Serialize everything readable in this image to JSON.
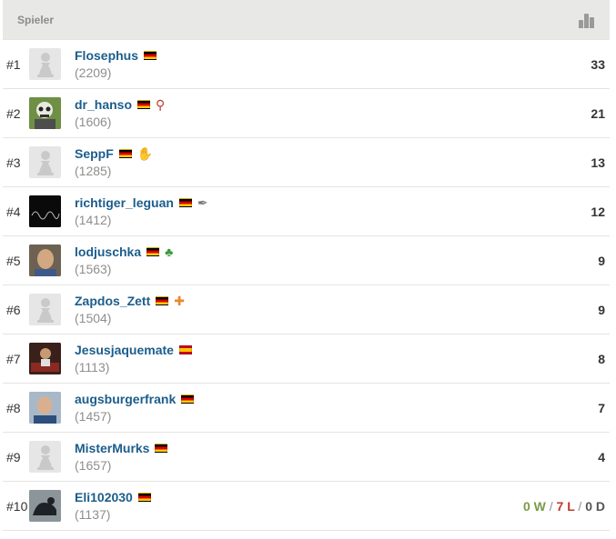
{
  "header": {
    "label": "Spieler",
    "icon": "leaderboard-icon"
  },
  "colors": {
    "link": "#1b5d8c",
    "rating": "#8e8e8c",
    "header_bg": "#e8e8e6",
    "win": "#7b9a4a",
    "loss": "#c0392b"
  },
  "rows": [
    {
      "rank": "#1",
      "username": "Flosephus",
      "rating": "(2209)",
      "flag": "de",
      "badge": "",
      "avatar": "pawn",
      "score": "33"
    },
    {
      "rank": "#2",
      "username": "dr_hanso",
      "rating": "(1606)",
      "flag": "de",
      "badge": "puzzle-badge-icon",
      "avatar": "photo",
      "score": "21"
    },
    {
      "rank": "#3",
      "username": "SeppF",
      "rating": "(1285)",
      "flag": "de",
      "badge": "clap-badge-icon",
      "avatar": "pawn",
      "score": "13"
    },
    {
      "rank": "#4",
      "username": "richtiger_leguan",
      "rating": "(1412)",
      "flag": "de",
      "badge": "feather-badge-icon",
      "avatar": "photo",
      "score": "12"
    },
    {
      "rank": "#5",
      "username": "lodjuschka",
      "rating": "(1563)",
      "flag": "de",
      "badge": "clover-badge-icon",
      "avatar": "photo",
      "score": "9"
    },
    {
      "rank": "#6",
      "username": "Zapdos_Zett",
      "rating": "(1504)",
      "flag": "de",
      "badge": "puzzle-piece-badge-icon",
      "avatar": "pawn",
      "score": "9"
    },
    {
      "rank": "#7",
      "username": "Jesusjaquemate",
      "rating": "(1113)",
      "flag": "es",
      "badge": "",
      "avatar": "photo",
      "score": "8"
    },
    {
      "rank": "#8",
      "username": "augsburgerfrank",
      "rating": "(1457)",
      "flag": "de",
      "badge": "",
      "avatar": "photo",
      "score": "7"
    },
    {
      "rank": "#9",
      "username": "MisterMurks",
      "rating": "(1657)",
      "flag": "de",
      "badge": "",
      "avatar": "pawn",
      "score": "4"
    },
    {
      "rank": "#10",
      "username": "Eli102030",
      "rating": "(1137)",
      "flag": "de",
      "badge": "",
      "avatar": "photo",
      "wins": "0 W",
      "losses": "7 L",
      "draws": "0 D",
      "sep": "/"
    }
  ]
}
